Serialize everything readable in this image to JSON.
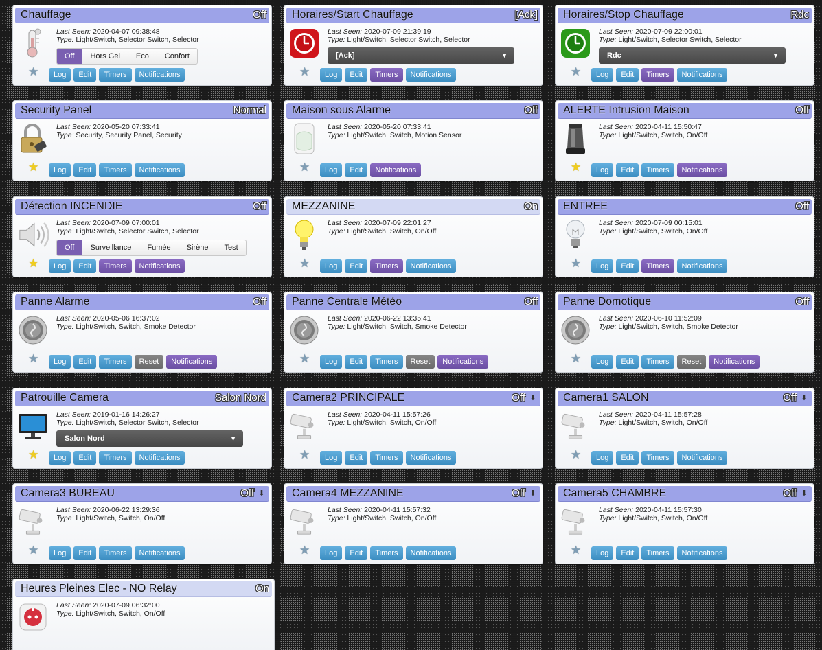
{
  "colors": {
    "header_off": "#9da3e8",
    "header_on": "#d3d9f3",
    "button_blue": "#4a9dd0",
    "button_purple": "#7a5fb1",
    "button_gray": "#787878",
    "dropdown": "#555555"
  },
  "labels": {
    "last_seen": "Last Seen:",
    "type": "Type:"
  },
  "buttons": {
    "log": "Log",
    "edit": "Edit",
    "timers": "Timers",
    "notifications": "Notifications",
    "reset": "Reset"
  },
  "devices": [
    {
      "name": "Chauffage",
      "status": "Off",
      "last_seen": "2020-04-07 09:38:48",
      "type": "Light/Switch, Selector Switch, Selector",
      "icon": "thermometer-icon",
      "selector": [
        "Off",
        "Hors Gel",
        "Eco",
        "Confort"
      ],
      "active": 0,
      "favorite": false
    },
    {
      "name": "Horaires/Start Chauffage",
      "status": "[Ack]",
      "last_seen": "2020-07-09 21:39:19",
      "type": "Light/Switch, Selector Switch, Selector",
      "icon": "red-clock-icon",
      "dropdown": "[Ack]",
      "favorite": false
    },
    {
      "name": "Horaires/Stop Chauffage",
      "status": "Rdc",
      "last_seen": "2020-07-09 22:00:01",
      "type": "Light/Switch, Selector Switch, Selector",
      "icon": "green-clock-icon",
      "dropdown": "Rdc",
      "favorite": false
    },
    {
      "name": "Security Panel",
      "status": "Normal",
      "last_seen": "2020-05-20 07:33:41",
      "type": "Security, Security Panel, Security",
      "icon": "padlock-icon",
      "favorite": true
    },
    {
      "name": "Maison sous Alarme",
      "status": "Off",
      "last_seen": "2020-05-20 07:33:41",
      "type": "Light/Switch, Switch, Motion Sensor",
      "icon": "motion-sensor-icon",
      "favorite": false
    },
    {
      "name": "ALERTE Intrusion Maison",
      "status": "Off",
      "last_seen": "2020-04-11 15:50:47",
      "type": "Light/Switch, Switch, On/Off",
      "icon": "siren-icon",
      "favorite": true
    },
    {
      "name": "Détection INCENDIE",
      "status": "Off",
      "last_seen": "2020-07-09 07:00:01",
      "type": "Light/Switch, Selector Switch, Selector",
      "icon": "speaker-icon",
      "selector": [
        "Off",
        "Surveillance",
        "Fumée",
        "Sirène",
        "Test"
      ],
      "active": 0,
      "favorite": true
    },
    {
      "name": "MEZZANINE",
      "status": "On",
      "last_seen": "2020-07-09 22:01:27",
      "type": "Light/Switch, Switch, On/Off",
      "icon": "bulb-on-icon",
      "favorite": false
    },
    {
      "name": "ENTREE",
      "status": "Off",
      "last_seen": "2020-07-09 00:15:01",
      "type": "Light/Switch, Switch, On/Off",
      "icon": "bulb-off-icon",
      "favorite": false
    },
    {
      "name": "Panne Alarme",
      "status": "Off",
      "last_seen": "2020-05-06 16:37:02",
      "type": "Light/Switch, Switch, Smoke Detector",
      "icon": "smoke-detector-icon",
      "favorite": false
    },
    {
      "name": "Panne Centrale Météo",
      "status": "Off",
      "last_seen": "2020-06-22 13:35:41",
      "type": "Light/Switch, Switch, Smoke Detector",
      "icon": "smoke-detector-icon",
      "favorite": false
    },
    {
      "name": "Panne Domotique",
      "status": "Off",
      "last_seen": "2020-06-10 11:52:09",
      "type": "Light/Switch, Switch, Smoke Detector",
      "icon": "smoke-detector-icon",
      "favorite": false
    },
    {
      "name": "Patrouille Camera",
      "status": "Salon Nord",
      "last_seen": "2019-01-16 14:26:27",
      "type": "Light/Switch, Selector Switch, Selector",
      "icon": "monitor-icon",
      "dropdown": "Salon Nord",
      "favorite": true
    },
    {
      "name": "Camera2 PRINCIPALE",
      "status": "Off",
      "last_seen": "2020-04-11 15:57:26",
      "type": "Light/Switch, Switch, On/Off",
      "icon": "camera-icon",
      "favorite": false
    },
    {
      "name": "Camera1 SALON",
      "status": "Off",
      "last_seen": "2020-04-11 15:57:28",
      "type": "Light/Switch, Switch, On/Off",
      "icon": "camera-icon",
      "favorite": false
    },
    {
      "name": "Camera3 BUREAU",
      "status": "Off",
      "last_seen": "2020-06-22 13:29:36",
      "type": "Light/Switch, Switch, On/Off",
      "icon": "camera-icon",
      "favorite": false
    },
    {
      "name": "Camera4 MEZZANINE",
      "status": "Off",
      "last_seen": "2020-04-11 15:57:32",
      "type": "Light/Switch, Switch, On/Off",
      "icon": "camera-icon",
      "favorite": false
    },
    {
      "name": "Camera5 CHAMBRE",
      "status": "Off",
      "last_seen": "2020-04-11 15:57:30",
      "type": "Light/Switch, Switch, On/Off",
      "icon": "camera-icon",
      "favorite": false
    },
    {
      "name": "Heures Pleines Elec - NO Relay",
      "status": "On",
      "last_seen": "2020-07-09 06:32:00",
      "type": "Light/Switch, Switch, On/Off",
      "icon": "wall-socket-icon",
      "favorite": false
    }
  ]
}
